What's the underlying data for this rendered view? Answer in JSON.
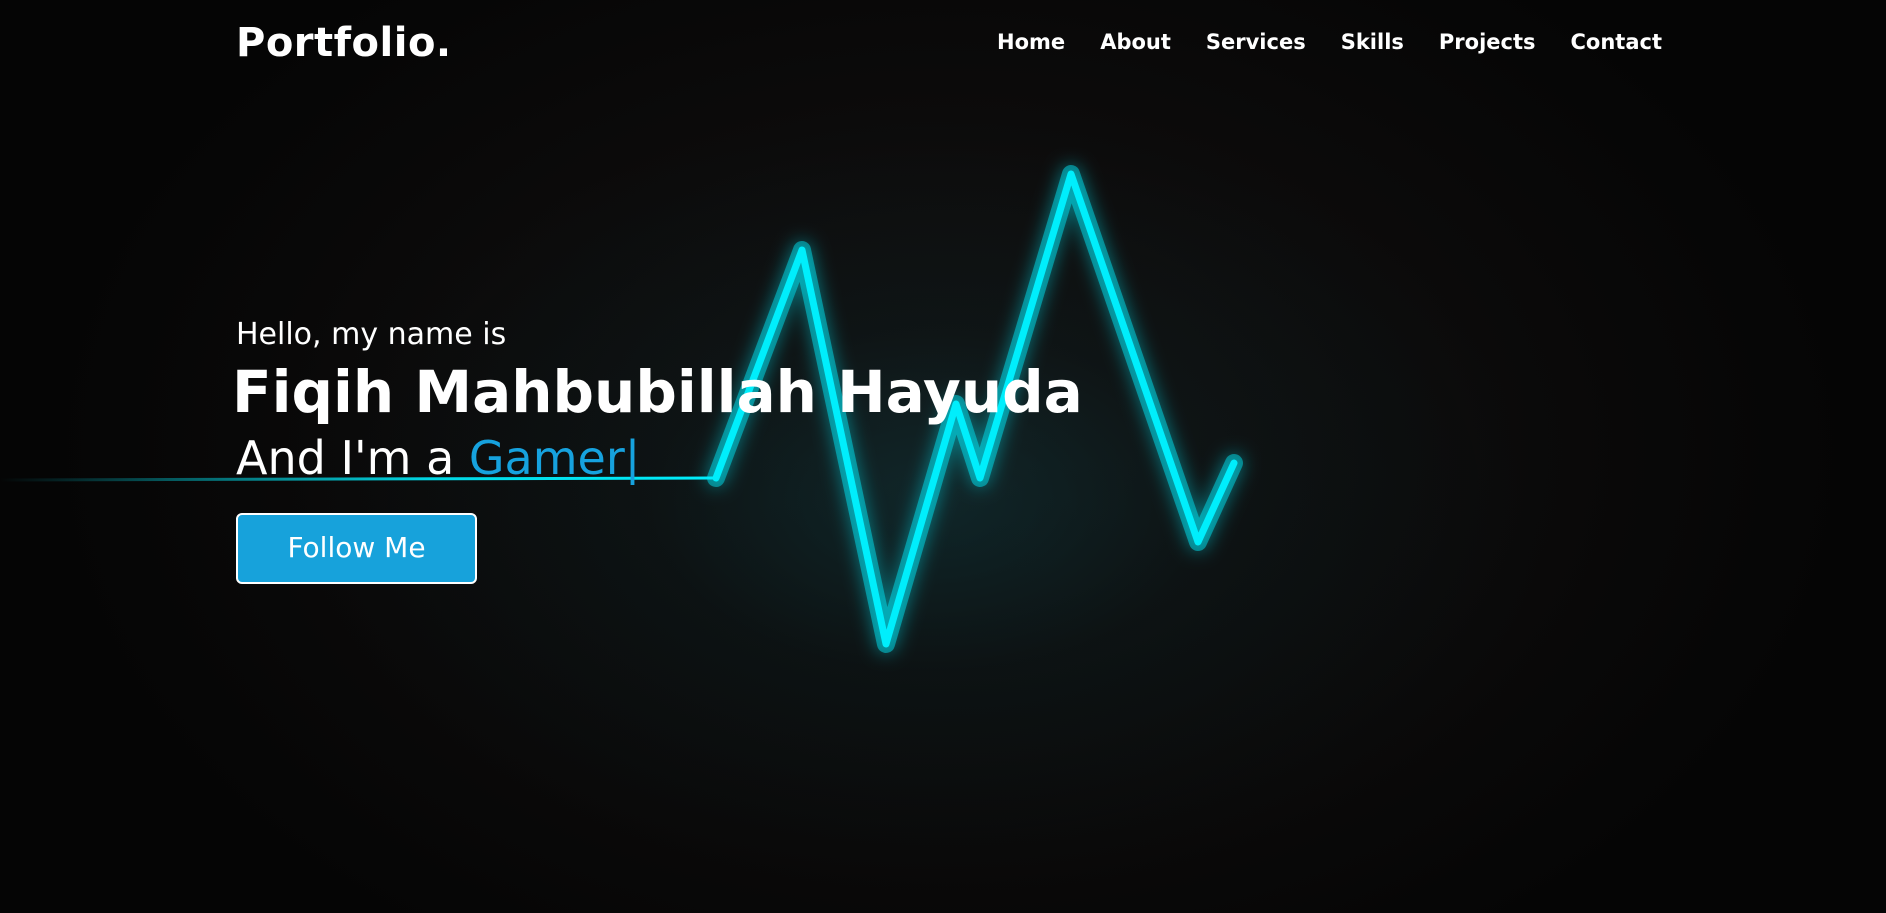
{
  "nav": {
    "logo": "Portfolio.",
    "links": [
      "Home",
      "About",
      "Services",
      "Skills",
      "Projects",
      "Contact"
    ]
  },
  "hero": {
    "greeting": "Hello, my name is",
    "name": "Fiqih Mahbubillah Hayuda",
    "role_prefix": "And I'm a ",
    "role_typed": "Gamer",
    "cursor": "|",
    "button_label": "Follow Me"
  },
  "colors": {
    "accent": "#16a2de",
    "pulse": "#00eefc",
    "background": "#050505"
  }
}
